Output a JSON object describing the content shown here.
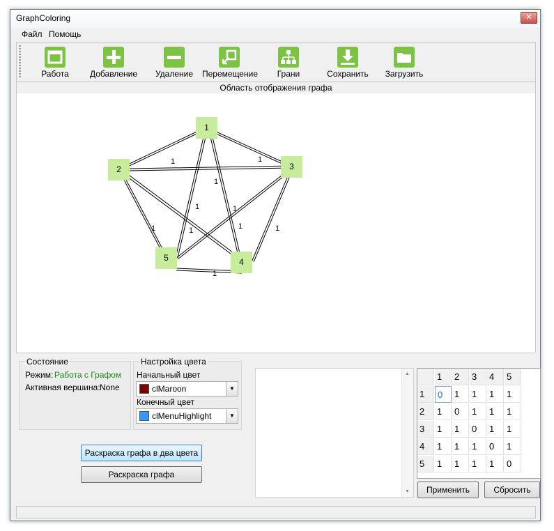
{
  "window": {
    "title": "GraphColoring",
    "close_glyph": "✕"
  },
  "menu": {
    "items": [
      "Файл",
      "Помощь"
    ]
  },
  "toolbar": {
    "buttons": [
      {
        "label": "Работа",
        "icon": "work-mode-icon"
      },
      {
        "label": "Добавление",
        "icon": "plus-icon"
      },
      {
        "label": "Удаление",
        "icon": "minus-icon"
      },
      {
        "label": "Перемещение",
        "icon": "move-icon"
      },
      {
        "label": "Грани",
        "icon": "edges-icon"
      },
      {
        "label": "Сохранить",
        "icon": "download-icon"
      },
      {
        "label": "Загрузить",
        "icon": "folder-icon"
      }
    ]
  },
  "graph_area": {
    "title": "Область отображения графа"
  },
  "graph": {
    "nodes": [
      "1",
      "2",
      "3",
      "4",
      "5"
    ],
    "edge_weight": "1"
  },
  "state": {
    "title": "Состояние",
    "mode_label": "Режим:",
    "mode_value": "Работа с Графом",
    "active_label": "Активная вершина:",
    "active_value": "None"
  },
  "color_settings": {
    "title": "Настройка цвета",
    "start_label": "Начальный цвет",
    "start_value": "clMaroon",
    "start_color": "#800000",
    "end_label": "Конечный цвет",
    "end_value": "clMenuHighlight",
    "end_color": "#3399ff"
  },
  "actions": {
    "two_color": "Раскраска графа в два цвета",
    "color_graph": "Раскраска графа"
  },
  "matrix": {
    "headers": [
      "1",
      "2",
      "3",
      "4",
      "5"
    ],
    "rows": [
      [
        "0",
        "1",
        "1",
        "1",
        "1"
      ],
      [
        "1",
        "0",
        "1",
        "1",
        "1"
      ],
      [
        "1",
        "1",
        "0",
        "1",
        "1"
      ],
      [
        "1",
        "1",
        "1",
        "0",
        "1"
      ],
      [
        "1",
        "1",
        "1",
        "1",
        "0"
      ]
    ],
    "apply": "Применить",
    "reset": "Сбросить"
  }
}
